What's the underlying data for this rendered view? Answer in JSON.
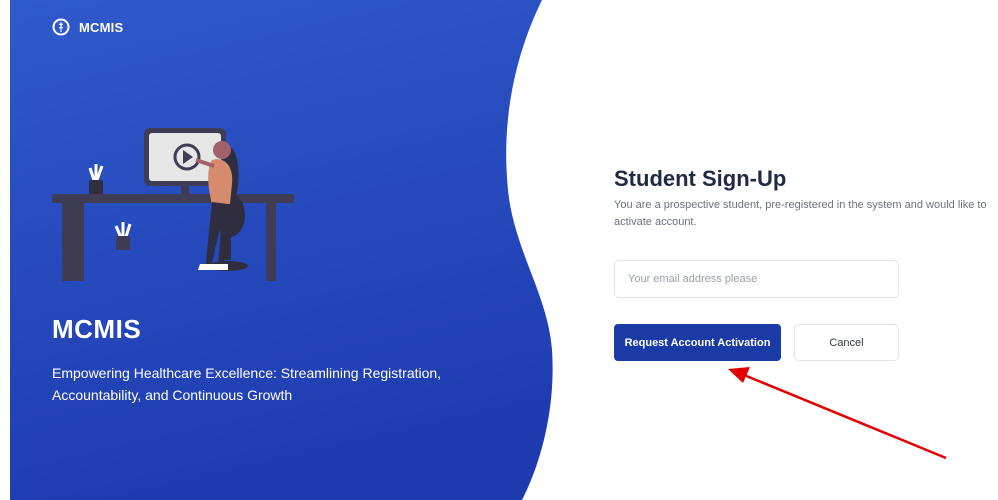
{
  "brand": {
    "name": "MCMIS",
    "logo_icon": "caduceus-logo-icon"
  },
  "hero": {
    "title": "MCMIS",
    "tagline": "Empowering Healthcare Excellence: Streamlining Registration, Accountability, and Continuous Growth",
    "illustration": "person-watching-video-illustration"
  },
  "form": {
    "title": "Student Sign-Up",
    "subtitle": "You are a prospective student, pre-registered in the system and would like to activate account.",
    "email_placeholder": "Your email address please",
    "submit_label": "Request Account Activation",
    "cancel_label": "Cancel"
  },
  "annotation": {
    "arrow_color": "#e00000",
    "target": "submit-button"
  },
  "colors": {
    "panel_blue_top": "#2e58c9",
    "panel_blue_bottom": "#1f3db3",
    "primary_button": "#1a3aa5"
  }
}
